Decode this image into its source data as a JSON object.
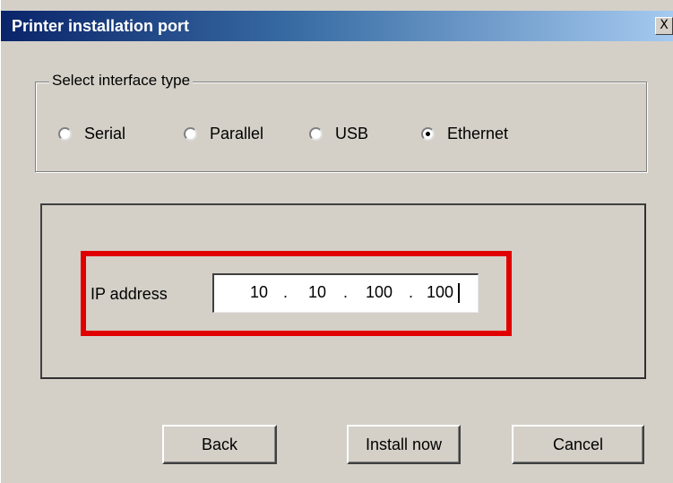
{
  "window": {
    "title": "Printer installation port",
    "close_label": "X"
  },
  "interface": {
    "group_label": "Select interface type",
    "options": [
      {
        "label": "Serial",
        "checked": false
      },
      {
        "label": "Parallel",
        "checked": false
      },
      {
        "label": "USB",
        "checked": false
      },
      {
        "label": "Ethernet",
        "checked": true
      }
    ]
  },
  "ip": {
    "label": "IP address",
    "octets": [
      "10",
      "10",
      "100",
      "100"
    ],
    "separator": "."
  },
  "buttons": {
    "back": "Back",
    "install": "Install now",
    "cancel": "Cancel"
  },
  "colors": {
    "highlight": "#e00000",
    "title_start": "#0a246a",
    "title_end": "#a6caf0",
    "face": "#d4d0c8"
  }
}
